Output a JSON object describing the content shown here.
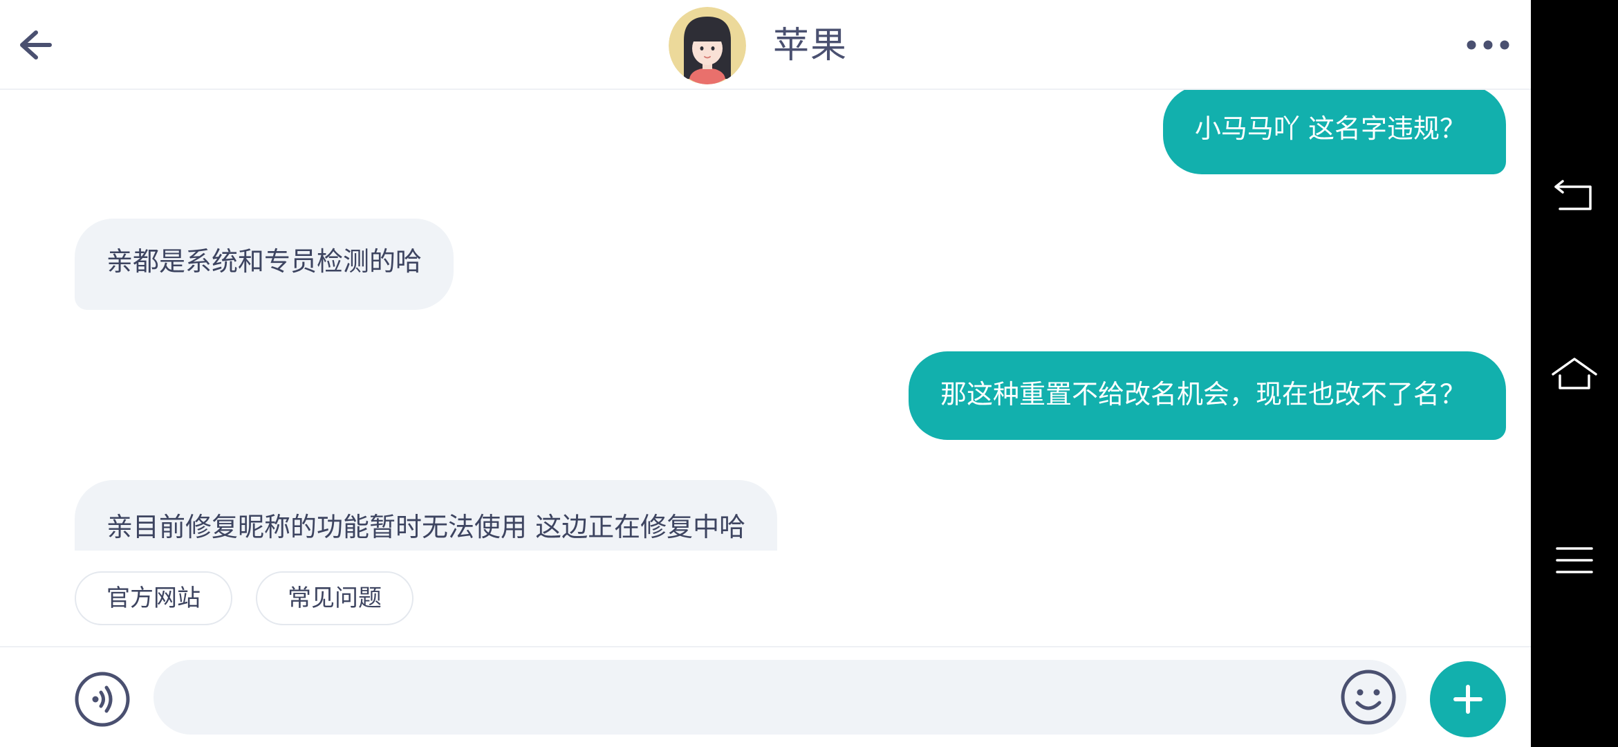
{
  "header": {
    "contact_name": "苹果"
  },
  "messages": [
    {
      "direction": "out",
      "text": "小马马吖 这名字违规？"
    },
    {
      "direction": "in",
      "text": "亲都是系统和专员检测的哈"
    },
    {
      "direction": "out",
      "text": "那这种重置不给改名机会，现在也改不了名？"
    },
    {
      "direction": "in",
      "text": "亲目前修复昵称的功能暂时无法使用 这边正在修复中哈"
    }
  ],
  "quick_replies": [
    "官方网站",
    "常见问题"
  ],
  "input": {
    "value": "",
    "placeholder": ""
  },
  "icons": {
    "back": "arrow-left-icon",
    "more": "more-dots-icon",
    "voice": "voice-icon",
    "emoji": "smile-emoji-icon",
    "plus": "plus-icon",
    "nav_back": "nav-back-icon",
    "nav_home": "nav-home-icon",
    "nav_menu": "nav-menu-icon"
  },
  "colors": {
    "accent": "#12b0ad",
    "bubble_in": "#f0f3f7",
    "text_primary": "#3d4460",
    "icon": "#4a5070",
    "navbar": "#000000"
  }
}
